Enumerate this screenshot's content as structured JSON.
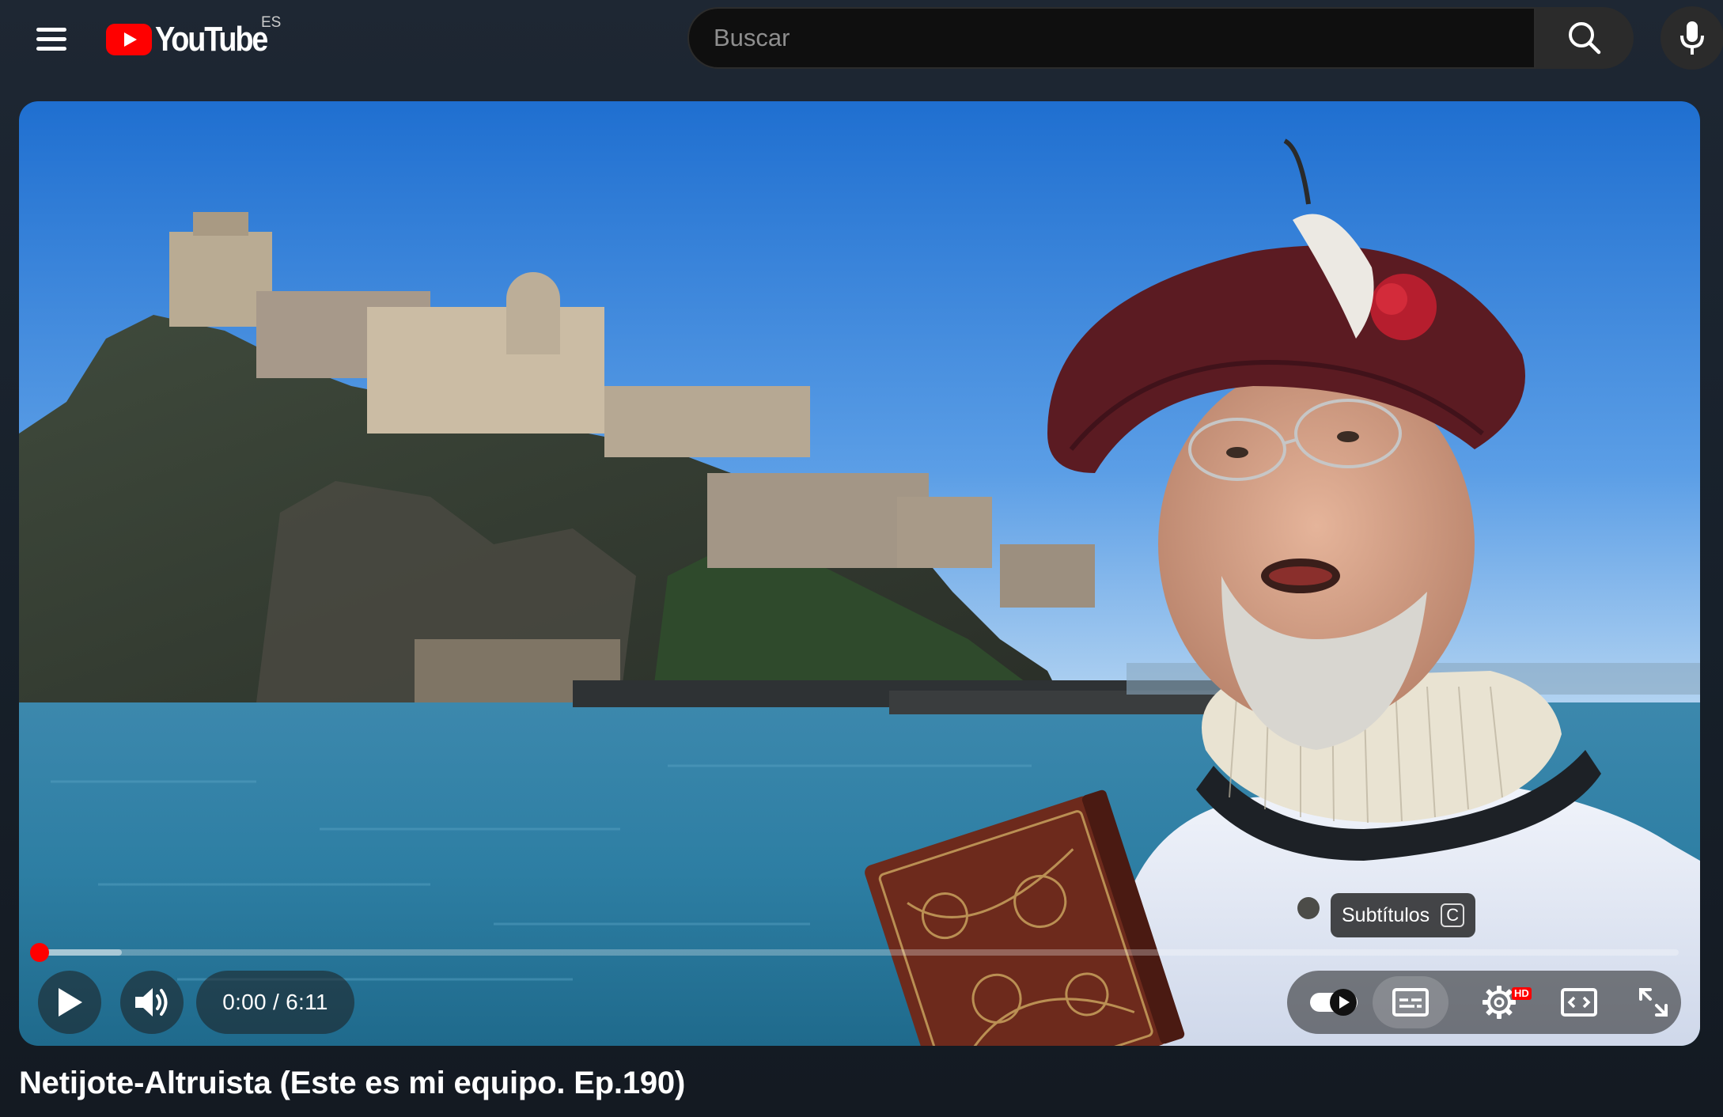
{
  "masthead": {
    "logo_text": "YouTube",
    "region_code": "ES",
    "search_placeholder": "Buscar",
    "menu_icon": "hamburger-menu-icon",
    "search_icon": "search-icon",
    "mic_icon": "microphone-icon",
    "brand_color": "#ff0000"
  },
  "player": {
    "time_display": "0:00 / 6:11",
    "current_time": "0:00",
    "duration": "6:11",
    "progress_played": 0.0,
    "progress_buffered": 0.05,
    "tooltip": {
      "label": "Subtítulos",
      "shortcut": "C"
    },
    "controls": {
      "play_icon": "play-icon",
      "volume_icon": "volume-icon",
      "autoplay_icon": "autoplay-toggle-icon",
      "subtitles_icon": "subtitles-icon",
      "settings_icon": "settings-gear-icon",
      "settings_badge": "HD",
      "theater_icon": "theater-mode-icon",
      "fullscreen_icon": "fullscreen-icon"
    }
  },
  "video": {
    "title": "Netijote-Altruista (Este es mi equipo. Ep.190)"
  }
}
